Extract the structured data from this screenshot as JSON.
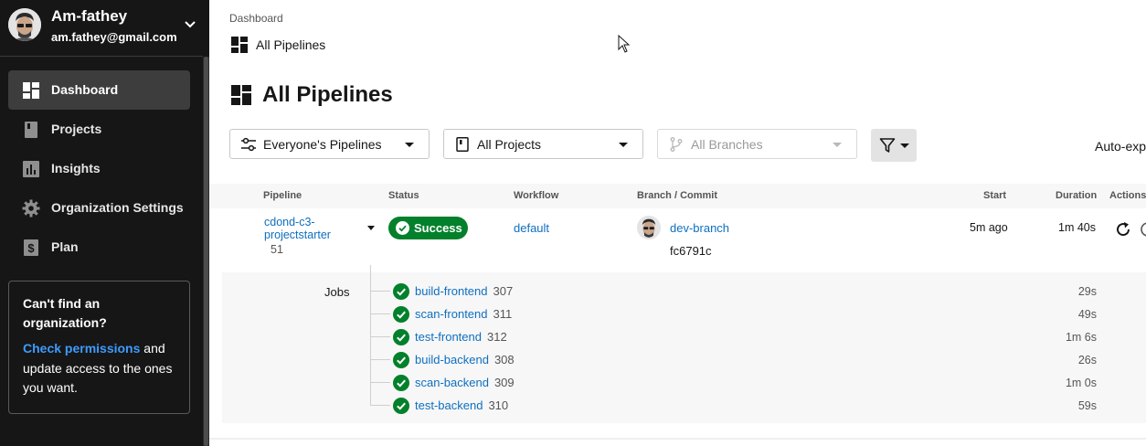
{
  "user": {
    "name": "Am-fathey",
    "email": "am.fathey@gmail.com"
  },
  "sidebar": {
    "items": [
      {
        "label": "Dashboard",
        "icon": "dashboard-icon",
        "active": true
      },
      {
        "label": "Projects",
        "icon": "book-icon",
        "active": false
      },
      {
        "label": "Insights",
        "icon": "chart-icon",
        "active": false
      },
      {
        "label": "Organization Settings",
        "icon": "gear-icon",
        "active": false
      },
      {
        "label": "Plan",
        "icon": "dollar-icon",
        "active": false
      }
    ],
    "help": {
      "title": "Can't find an organization?",
      "link": "Check permissions",
      "text": " and update access to the ones you want."
    }
  },
  "header": {
    "breadcrumb": "Dashboard",
    "subtitle": "All Pipelines",
    "title": "All Pipelines"
  },
  "filters": {
    "pipelines": "Everyone's Pipelines",
    "projects": "All Projects",
    "branches": "All Branches",
    "auto_expand": "Auto-exp"
  },
  "table": {
    "columns": {
      "pipeline": "Pipeline",
      "status": "Status",
      "workflow": "Workflow",
      "branch_commit": "Branch / Commit",
      "start": "Start",
      "duration": "Duration",
      "actions": "Actions"
    },
    "row": {
      "pipeline_line1": "cdond-c3-",
      "pipeline_line2": "projectstarter",
      "pipeline_number": "51",
      "status": "Success",
      "workflow": "default",
      "branch": "dev-branch",
      "commit": "fc6791c",
      "start": "5m ago",
      "duration": "1m 40s"
    },
    "jobs_label": "Jobs",
    "jobs": [
      {
        "name": "build-frontend",
        "number": "307",
        "duration": "29s"
      },
      {
        "name": "scan-frontend",
        "number": "311",
        "duration": "49s"
      },
      {
        "name": "test-frontend",
        "number": "312",
        "duration": "1m 6s"
      },
      {
        "name": "build-backend",
        "number": "308",
        "duration": "26s"
      },
      {
        "name": "scan-backend",
        "number": "309",
        "duration": "1m 0s"
      },
      {
        "name": "test-backend",
        "number": "310",
        "duration": "59s"
      }
    ]
  },
  "colors": {
    "success": "#03802b",
    "link": "#0e6fc0",
    "sidebar_bg": "#161616"
  }
}
